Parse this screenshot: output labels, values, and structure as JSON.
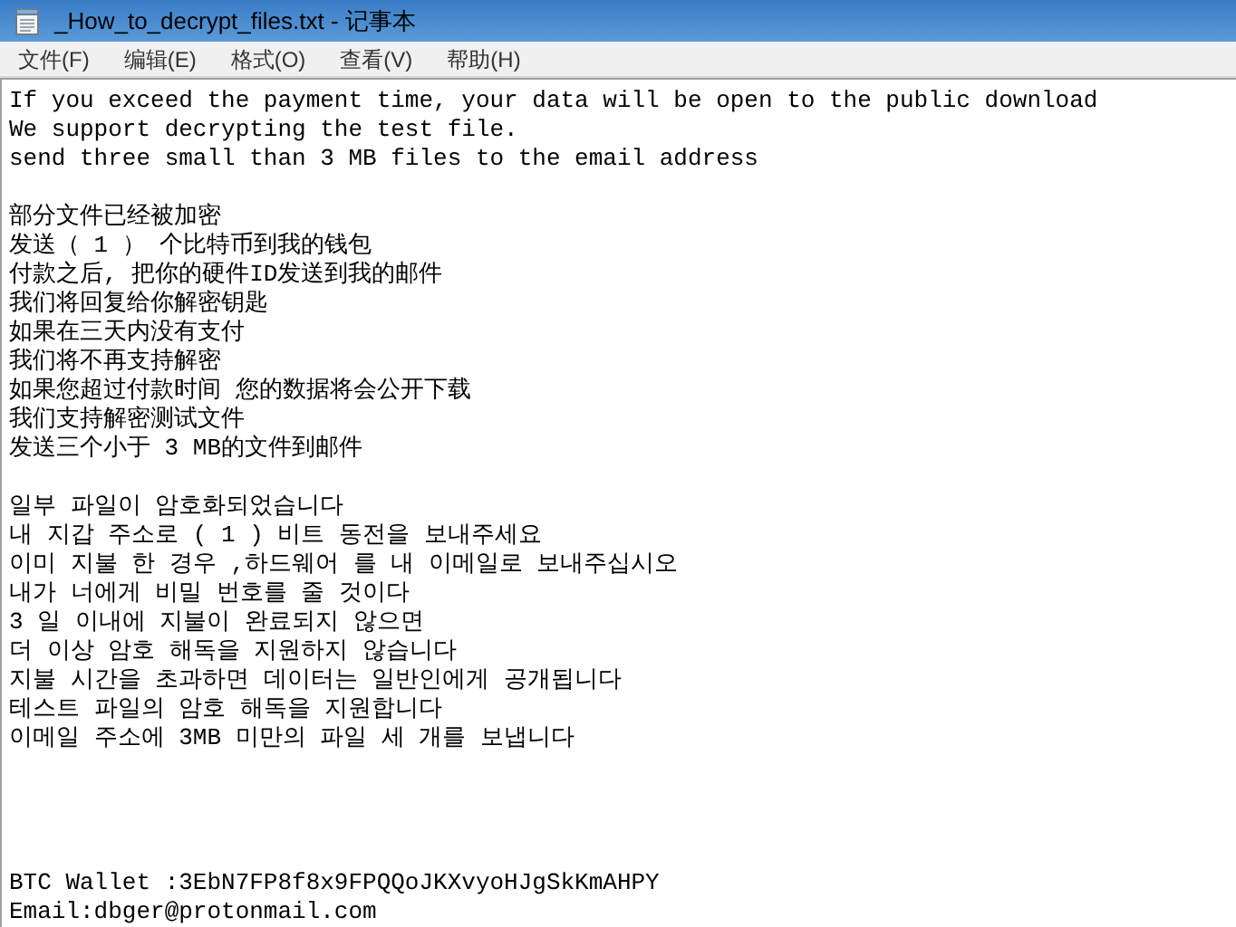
{
  "window": {
    "title": "_How_to_decrypt_files.txt - 记事本"
  },
  "menu": [
    "文件(F)",
    "编辑(E)",
    "格式(O)",
    "查看(V)",
    "帮助(H)"
  ],
  "blocks": [
    {
      "kind": "body",
      "lines": [
        "If you exceed the payment time, your data will be open to the public download",
        "We support decrypting the test file.",
        "send three small than 3 MB files to the email address"
      ]
    },
    {
      "kind": "body",
      "lines": [
        "部分文件已经被加密",
        "发送（ 1 ） 个比特币到我的钱包",
        "付款之后, 把你的硬件ID发送到我的邮件",
        "我们将回复给你解密钥匙",
        "如果在三天内没有支付",
        "我们将不再支持解密",
        "如果您超过付款时间 您的数据将会公开下载",
        "我们支持解密测试文件",
        "发送三个小于 3 MB的文件到邮件"
      ]
    },
    {
      "kind": "body",
      "lines": [
        "일부 파일이 암호화되었습니다",
        "내 지갑 주소로 ( 1 ) 비트 동전을 보내주세요",
        "이미 지불 한 경우 ,하드웨어 를 내 이메일로 보내주십시오",
        "내가 너에게 비밀 번호를 줄 것이다",
        "3 일 이내에 지불이 완료되지 않으면",
        "더 이상 암호 해독을 지원하지 않습니다",
        "지불 시간을 초과하면 데이터는 일반인에게 공개됩니다",
        "테스트 파일의 암호 해독을 지원합니다",
        "이메일 주소에 3MB 미만의 파일 세 개를 보냅니다"
      ]
    },
    {
      "kind": "footer",
      "lines": [
        "BTC Wallet :3EbN7FP8f8x9FPQQoJKXvyoHJgSkKmAHPY",
        "Email:dbger@protonmail.com"
      ]
    }
  ]
}
